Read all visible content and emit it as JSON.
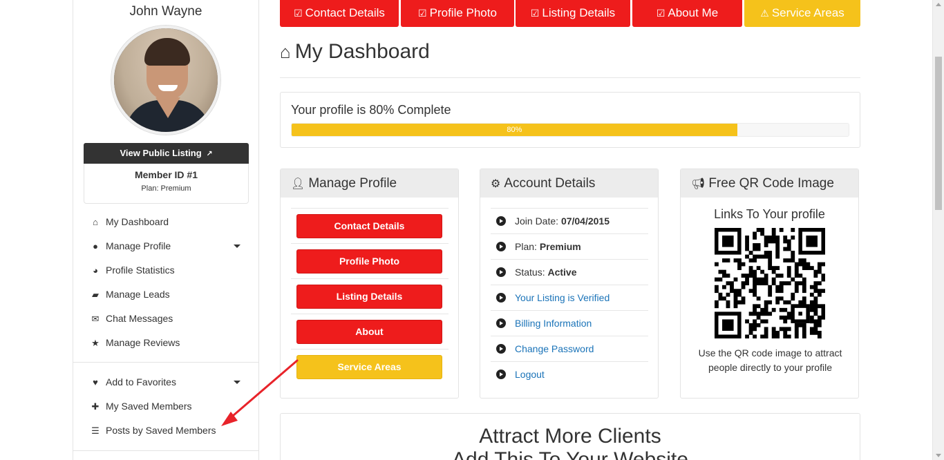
{
  "sidebar": {
    "member_name": "John Wayne",
    "view_listing_label": "View Public Listing",
    "member_id": "Member ID #1",
    "plan_line": "Plan: Premium",
    "nav_top": [
      {
        "label": "My Dashboard",
        "icon": "home-icon",
        "glyph": "⌂",
        "caret": false
      },
      {
        "label": "Manage Profile",
        "icon": "user-circle-icon",
        "glyph": "●",
        "caret": true
      },
      {
        "label": "Profile Statistics",
        "icon": "pie-chart-icon",
        "glyph": "◕",
        "caret": false
      },
      {
        "label": "Manage Leads",
        "icon": "folder-open-icon",
        "glyph": "▰",
        "caret": false
      },
      {
        "label": "Chat Messages",
        "icon": "comments-icon",
        "glyph": "✉",
        "caret": false
      },
      {
        "label": "Manage Reviews",
        "icon": "star-icon",
        "glyph": "★",
        "caret": false
      }
    ],
    "nav_bottom": [
      {
        "label": "Add to Favorites",
        "icon": "heart-icon",
        "glyph": "♥",
        "caret": true
      },
      {
        "label": "My Saved Members",
        "icon": "user-plus-icon",
        "glyph": "✚",
        "caret": false
      },
      {
        "label": "Posts by Saved Members",
        "icon": "list-icon",
        "glyph": "☰",
        "caret": false
      }
    ]
  },
  "tabs": [
    {
      "label": "Contact Details",
      "style": "red",
      "icon": "check-square-icon"
    },
    {
      "label": "Profile Photo",
      "style": "red",
      "icon": "check-square-icon"
    },
    {
      "label": "Listing Details",
      "style": "red",
      "icon": "check-square-icon"
    },
    {
      "label": "About Me",
      "style": "red",
      "icon": "check-square-icon"
    },
    {
      "label": "Service Areas",
      "style": "warn",
      "icon": "warning-icon"
    }
  ],
  "page_title": "My Dashboard",
  "progress": {
    "text": "Your profile is 80% Complete",
    "percent": 80,
    "bar_label": "80%"
  },
  "manage_profile": {
    "title": "Manage Profile",
    "buttons": [
      {
        "label": "Contact Details",
        "style": "red"
      },
      {
        "label": "Profile Photo",
        "style": "red"
      },
      {
        "label": "Listing Details",
        "style": "red"
      },
      {
        "label": "About",
        "style": "red"
      },
      {
        "label": "Service Areas",
        "style": "warn"
      }
    ]
  },
  "account_details": {
    "title": "Account Details",
    "join_label": "Join Date:",
    "join_value": "07/04/2015",
    "plan_label": "Plan:",
    "plan_value": "Premium",
    "status_label": "Status:",
    "status_value": "Active",
    "links": [
      "Your Listing is Verified",
      "Billing Information",
      "Change Password",
      "Logout"
    ]
  },
  "qr": {
    "title": "Free QR Code Image",
    "subtitle": "Links To Your profile",
    "caption": "Use the QR code image to attract people directly to your profile"
  },
  "attract": {
    "title": "Attract More Clients",
    "subtitle": "Add This To Your Website"
  },
  "colors": {
    "red": "#ee1c1c",
    "warn": "#f5c21b",
    "link": "#1a73b8"
  }
}
